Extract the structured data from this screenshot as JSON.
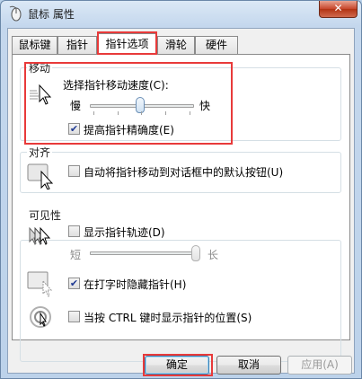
{
  "window": {
    "title": "鼠标 属性",
    "close_label": "✕"
  },
  "tabs": [
    {
      "label": "鼠标键"
    },
    {
      "label": "指针"
    },
    {
      "label": "指针选项"
    },
    {
      "label": "滑轮"
    },
    {
      "label": "硬件"
    }
  ],
  "active_tab": "指针选项",
  "motion": {
    "title": "移动",
    "speed_label": "选择指针移动速度(C):",
    "slow_label": "慢",
    "fast_label": "快",
    "speed_fraction": 0.5,
    "precision_label": "提高指针精确度(E)",
    "precision_checked": true
  },
  "snap": {
    "title": "对齐",
    "label": "自动将指针移动到对话框中的默认按钮(U)",
    "checked": false
  },
  "visibility": {
    "title": "可见性",
    "trails_label": "显示指针轨迹(D)",
    "trails_checked": false,
    "short_label": "短",
    "long_label": "长",
    "trails_fraction": 0.93,
    "hide_label": "在打字时隐藏指针(H)",
    "hide_checked": true,
    "ctrl_label": "当按 CTRL 键时显示指针的位置(S)",
    "ctrl_checked": false
  },
  "buttons": {
    "ok": "确定",
    "cancel": "取消",
    "apply": "应用(A)"
  },
  "colors": {
    "highlight": "#e83a3a",
    "check": "#1f3a93"
  }
}
